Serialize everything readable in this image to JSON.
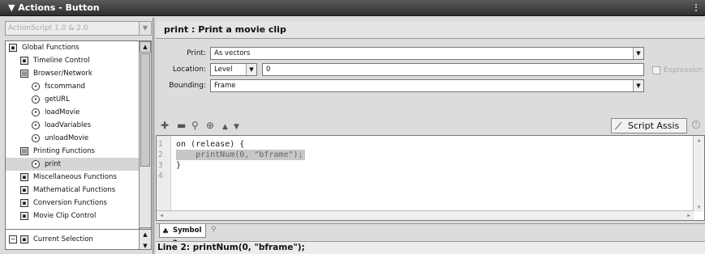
{
  "window": {
    "title": "▼ Actions - Button"
  },
  "left_panel": {
    "version_select": "ActionScript 1.0 & 2.0",
    "tree": [
      {
        "label": "Global Functions",
        "icon": "book-icon",
        "level": 0
      },
      {
        "label": "Timeline Control",
        "icon": "book-icon",
        "level": 1
      },
      {
        "label": "Browser/Network",
        "icon": "book-open-icon",
        "level": 1
      },
      {
        "label": "fscommand",
        "icon": "action-icon",
        "level": 2
      },
      {
        "label": "getURL",
        "icon": "action-icon",
        "level": 2
      },
      {
        "label": "loadMovie",
        "icon": "action-icon",
        "level": 2
      },
      {
        "label": "loadVariables",
        "icon": "action-icon",
        "level": 2
      },
      {
        "label": "unloadMovie",
        "icon": "action-icon",
        "level": 2
      },
      {
        "label": "Printing Functions",
        "icon": "book-open-icon",
        "level": 1
      },
      {
        "label": "print",
        "icon": "action-icon",
        "level": 2,
        "selected": true
      },
      {
        "label": "Miscellaneous Functions",
        "icon": "book-icon",
        "level": 1
      },
      {
        "label": "Mathematical Functions",
        "icon": "book-icon",
        "level": 1
      },
      {
        "label": "Conversion Functions",
        "icon": "book-icon",
        "level": 1
      },
      {
        "label": "Movie Clip Control",
        "icon": "book-icon",
        "level": 1
      }
    ],
    "current_selection": "Current Selection"
  },
  "right_panel": {
    "header": "print : Print a movie clip",
    "print": {
      "label": "Print:",
      "value": "As vectors"
    },
    "location": {
      "label": "Location:",
      "value": "Level",
      "level_value": "0"
    },
    "expression": {
      "label": "Expression"
    },
    "bounding": {
      "label": "Bounding:",
      "value": "Frame"
    },
    "script_assist": "Script Assis",
    "code_lines": [
      {
        "n": "1",
        "text": "on (release) {"
      },
      {
        "n": "2",
        "text": "    printNum(0, \"bframe\");",
        "highlight": true
      },
      {
        "n": "3",
        "text": "}"
      },
      {
        "n": "4",
        "text": ""
      }
    ],
    "tab": "Symbol 2",
    "status": "Line 2: printNum(0, \"bframe\");"
  }
}
